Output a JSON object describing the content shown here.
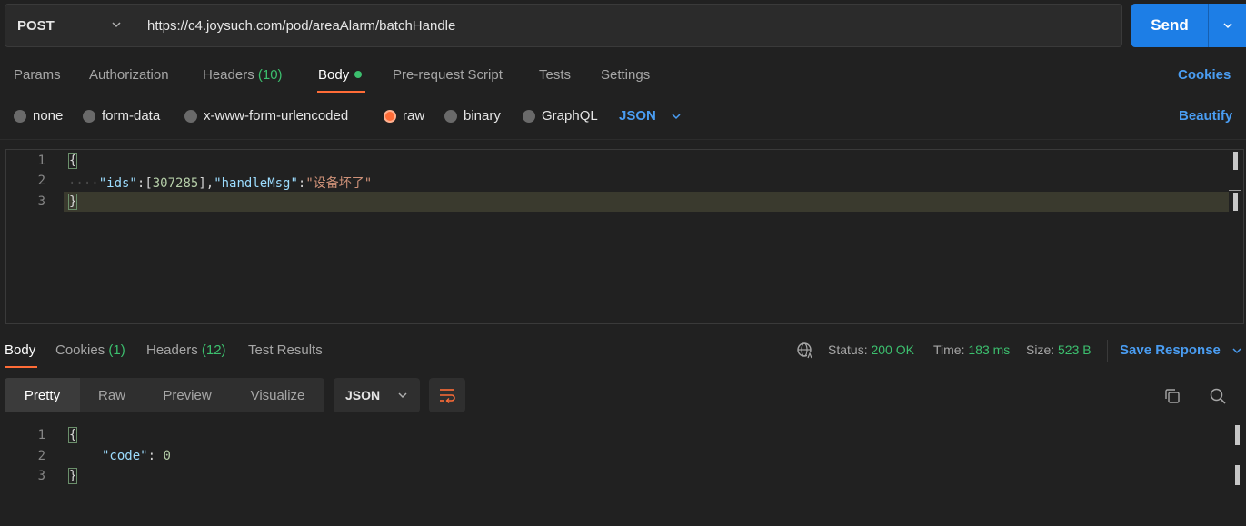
{
  "request": {
    "method": "POST",
    "url": "https://c4.joysuch.com/pod/areaAlarm/batchHandle",
    "send_label": "Send"
  },
  "request_tabs": [
    {
      "label": "Params"
    },
    {
      "label": "Authorization"
    },
    {
      "label": "Headers",
      "count": "(10)"
    },
    {
      "label": "Body",
      "active": true
    },
    {
      "label": "Pre-request Script"
    },
    {
      "label": "Tests"
    },
    {
      "label": "Settings"
    }
  ],
  "cookies_link": "Cookies",
  "body_modes": [
    "none",
    "form-data",
    "x-www-form-urlencoded",
    "raw",
    "binary",
    "GraphQL"
  ],
  "body_selected_mode": "raw",
  "body_format": "JSON",
  "beautify_link": "Beautify",
  "request_body": {
    "line_numbers": [
      "1",
      "2",
      "3"
    ],
    "open_brace": "{",
    "close_brace": "}",
    "key_ids": "\"ids\"",
    "colon": ":",
    "bracket_open": "[",
    "ids_value": "307285",
    "bracket_close": "]",
    "comma": ",",
    "key_handle": "\"handleMsg\"",
    "handle_value": "\"设备坏了\""
  },
  "response_tabs": [
    {
      "label": "Body",
      "active": true
    },
    {
      "label": "Cookies",
      "count": "(1)"
    },
    {
      "label": "Headers",
      "count": "(12)"
    },
    {
      "label": "Test Results"
    }
  ],
  "response_status": {
    "status_label": "Status:",
    "status_value": "200 OK",
    "time_label": "Time:",
    "time_value": "183 ms",
    "size_label": "Size:",
    "size_value": "523 B"
  },
  "save_response": "Save Response",
  "view_modes": [
    "Pretty",
    "Raw",
    "Preview",
    "Visualize"
  ],
  "response_format": "JSON",
  "response_body": {
    "line_numbers": [
      "1",
      "2",
      "3"
    ],
    "open_brace": "{",
    "key": "\"code\"",
    "colon": ":",
    "value": "0",
    "close_brace": "}"
  },
  "colors": {
    "accent": "#ff6c37",
    "primary_blue": "#1d7ee6",
    "success_green": "#3cbf6e"
  }
}
